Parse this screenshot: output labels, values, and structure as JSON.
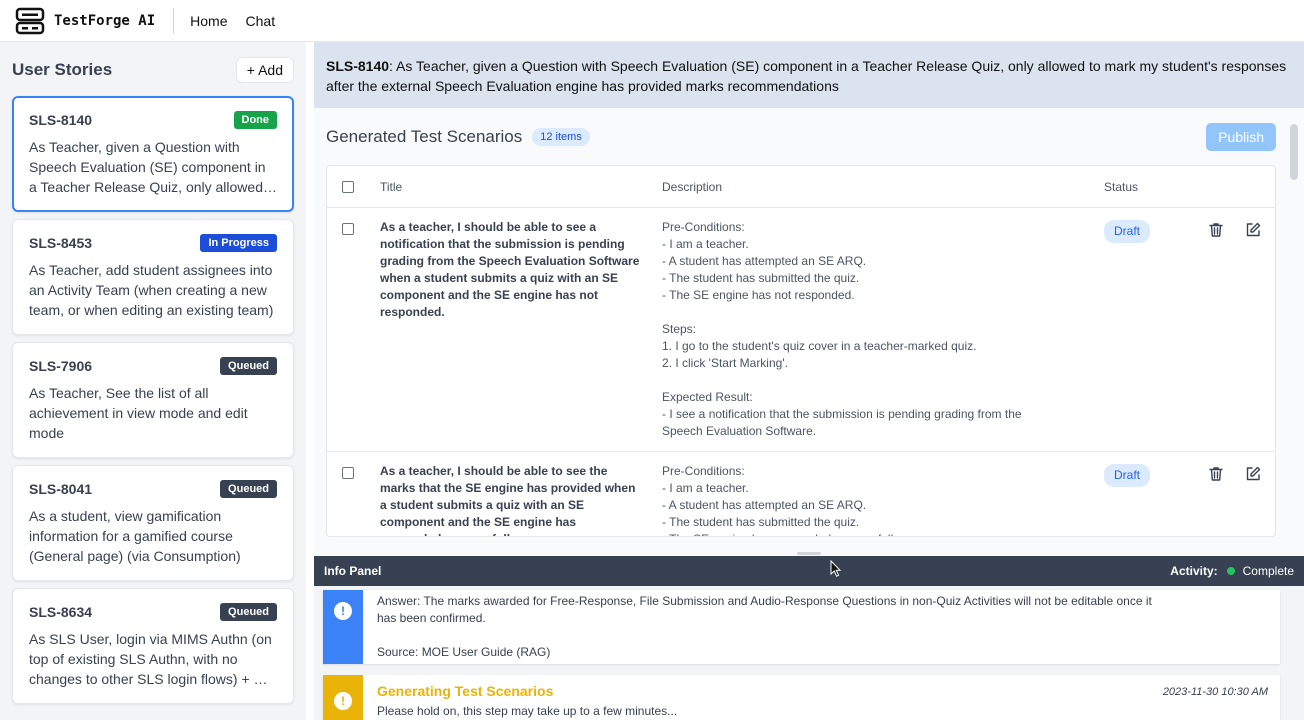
{
  "app": {
    "name": "TestForge AI"
  },
  "nav": {
    "home": "Home",
    "chat": "Chat"
  },
  "sidebar": {
    "title": "User Stories",
    "add_label": "+ Add",
    "stories": [
      {
        "id": "SLS-8140",
        "status": "Done",
        "desc": "As Teacher, given a Question with Speech Evaluation (SE) component in a Teacher Release Quiz, only allowed to mark my student's responses after the external Speech Evaluation engine has provided marks recommendations"
      },
      {
        "id": "SLS-8453",
        "status": "In Progress",
        "desc": "As Teacher, add student assignees into an Activity Team (when creating a new team, or when editing an existing team)"
      },
      {
        "id": "SLS-7906",
        "status": "Queued",
        "desc": "As Teacher, See the list of all achievement in view mode and edit mode"
      },
      {
        "id": "SLS-8041",
        "status": "Queued",
        "desc": "As a student, view gamification information for a gamified course (General page) (via Consumption)"
      },
      {
        "id": "SLS-8634",
        "status": "Queued",
        "desc": "As SLS User, login via MIMS Authn (on top of existing SLS Authn, with no changes to other SLS login flows) + UI changes"
      }
    ]
  },
  "story_header": {
    "id": "SLS-8140",
    "text": ": As Teacher, given a Question with Speech Evaluation (SE) component in a Teacher Release Quiz, only allowed to mark my student's responses after the external Speech Evaluation engine has provided marks recommendations"
  },
  "scenarios": {
    "title": "Generated Test Scenarios",
    "count": "12 items",
    "publish_label": "Publish",
    "columns": {
      "title": "Title",
      "description": "Description",
      "status": "Status"
    },
    "rows": [
      {
        "title": "As a teacher, I should be able to see a notification that the submission is pending grading from the Speech Evaluation Software when a student submits a quiz with an SE component and the SE engine has not responded.",
        "description": "Pre-Conditions:\n- I am a teacher.\n- A student has attempted an SE ARQ.\n- The student has submitted the quiz.\n- The SE engine has not responded.\n\nSteps:\n1. I go to the student's quiz cover in a teacher-marked quiz.\n2. I click 'Start Marking'.\n\nExpected Result:\n- I see a notification that the submission is pending grading from the Speech Evaluation Software.",
        "status": "Draft"
      },
      {
        "title": "As a teacher, I should be able to see the marks that the SE engine has provided when a student submits a quiz with an SE component and the SE engine has responded successfully.",
        "description": "Pre-Conditions:\n- I am a teacher.\n- A student has attempted an SE ARQ.\n- The student has submitted the quiz.\n- The SE engine has responded successfully.",
        "status": "Draft"
      }
    ]
  },
  "info_panel": {
    "title": "Info Panel",
    "activity_label": "Activity:",
    "activity_status": "Complete",
    "cards": [
      {
        "answer": "Answer: The marks awarded for Free-Response, File Submission and Audio-Response Questions in non-Quiz Activities will not be editable once it has been confirmed.",
        "source": "Source: MOE User Guide (RAG)"
      },
      {
        "heading": "Generating Test Scenarios",
        "text": "Please hold on, this step may take up to a few minutes...",
        "time": "2023-11-30 10:30 AM"
      }
    ]
  },
  "colors": {
    "accent": "#3b82f6",
    "done": "#16a34a",
    "in_progress": "#1d4ed8",
    "queued": "#374151",
    "warning": "#eab308"
  }
}
